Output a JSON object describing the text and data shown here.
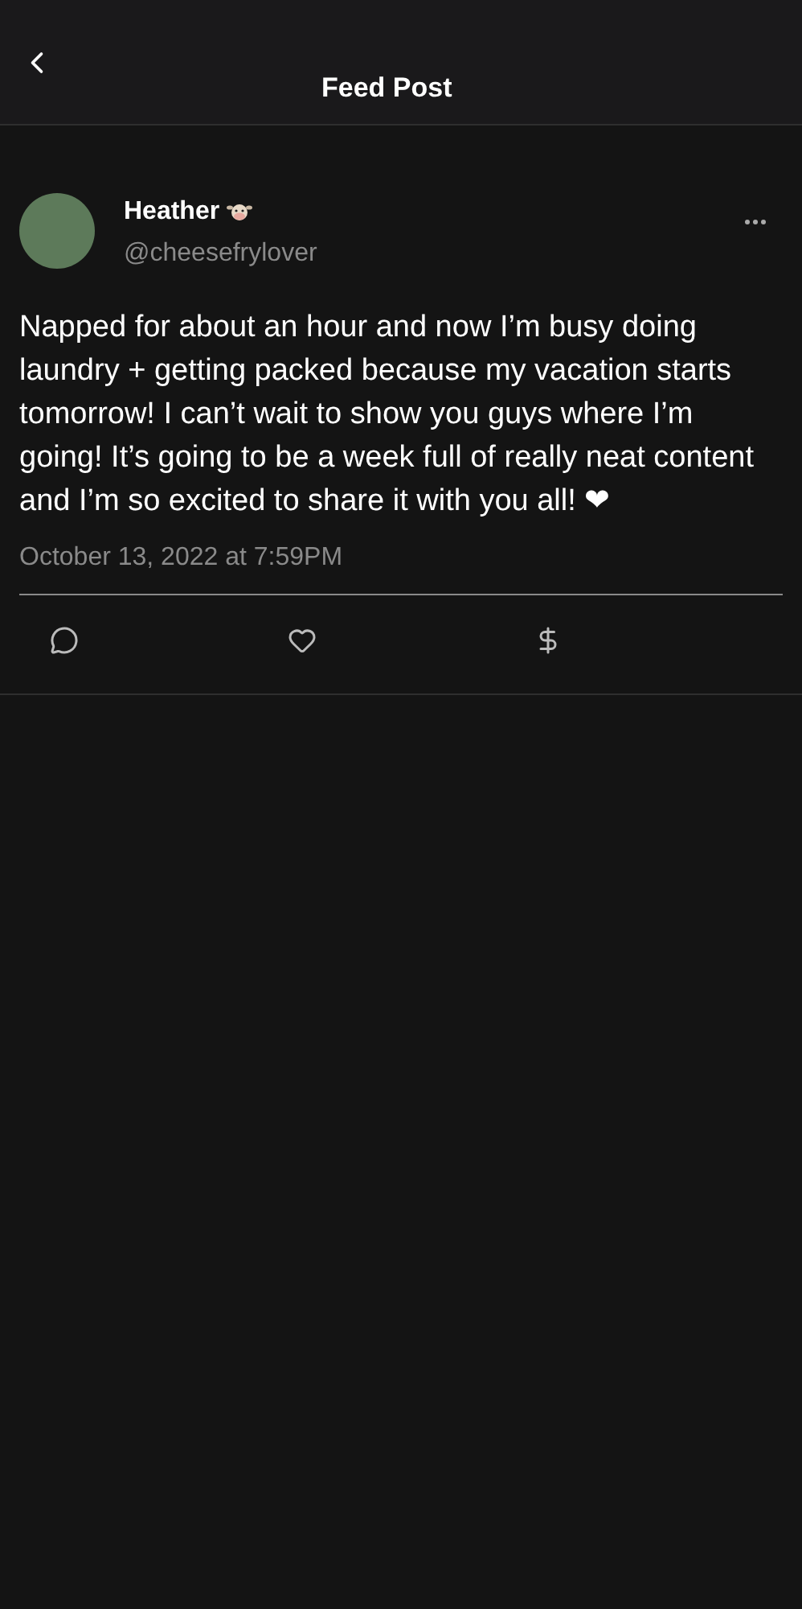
{
  "header": {
    "title": "Feed Post"
  },
  "post": {
    "author": {
      "name": "Heather",
      "handle": "@cheesefrylover"
    },
    "text": "Napped for about an hour and now I’m busy doing laundry + getting packed because my vacation starts tomorrow! I can’t wait to show you guys where I’m going! It’s going to be a week full of really neat content and I’m so excited to share it with you all! ❤",
    "timestamp": "October 13, 2022 at 7:59PM",
    "liked": false
  }
}
